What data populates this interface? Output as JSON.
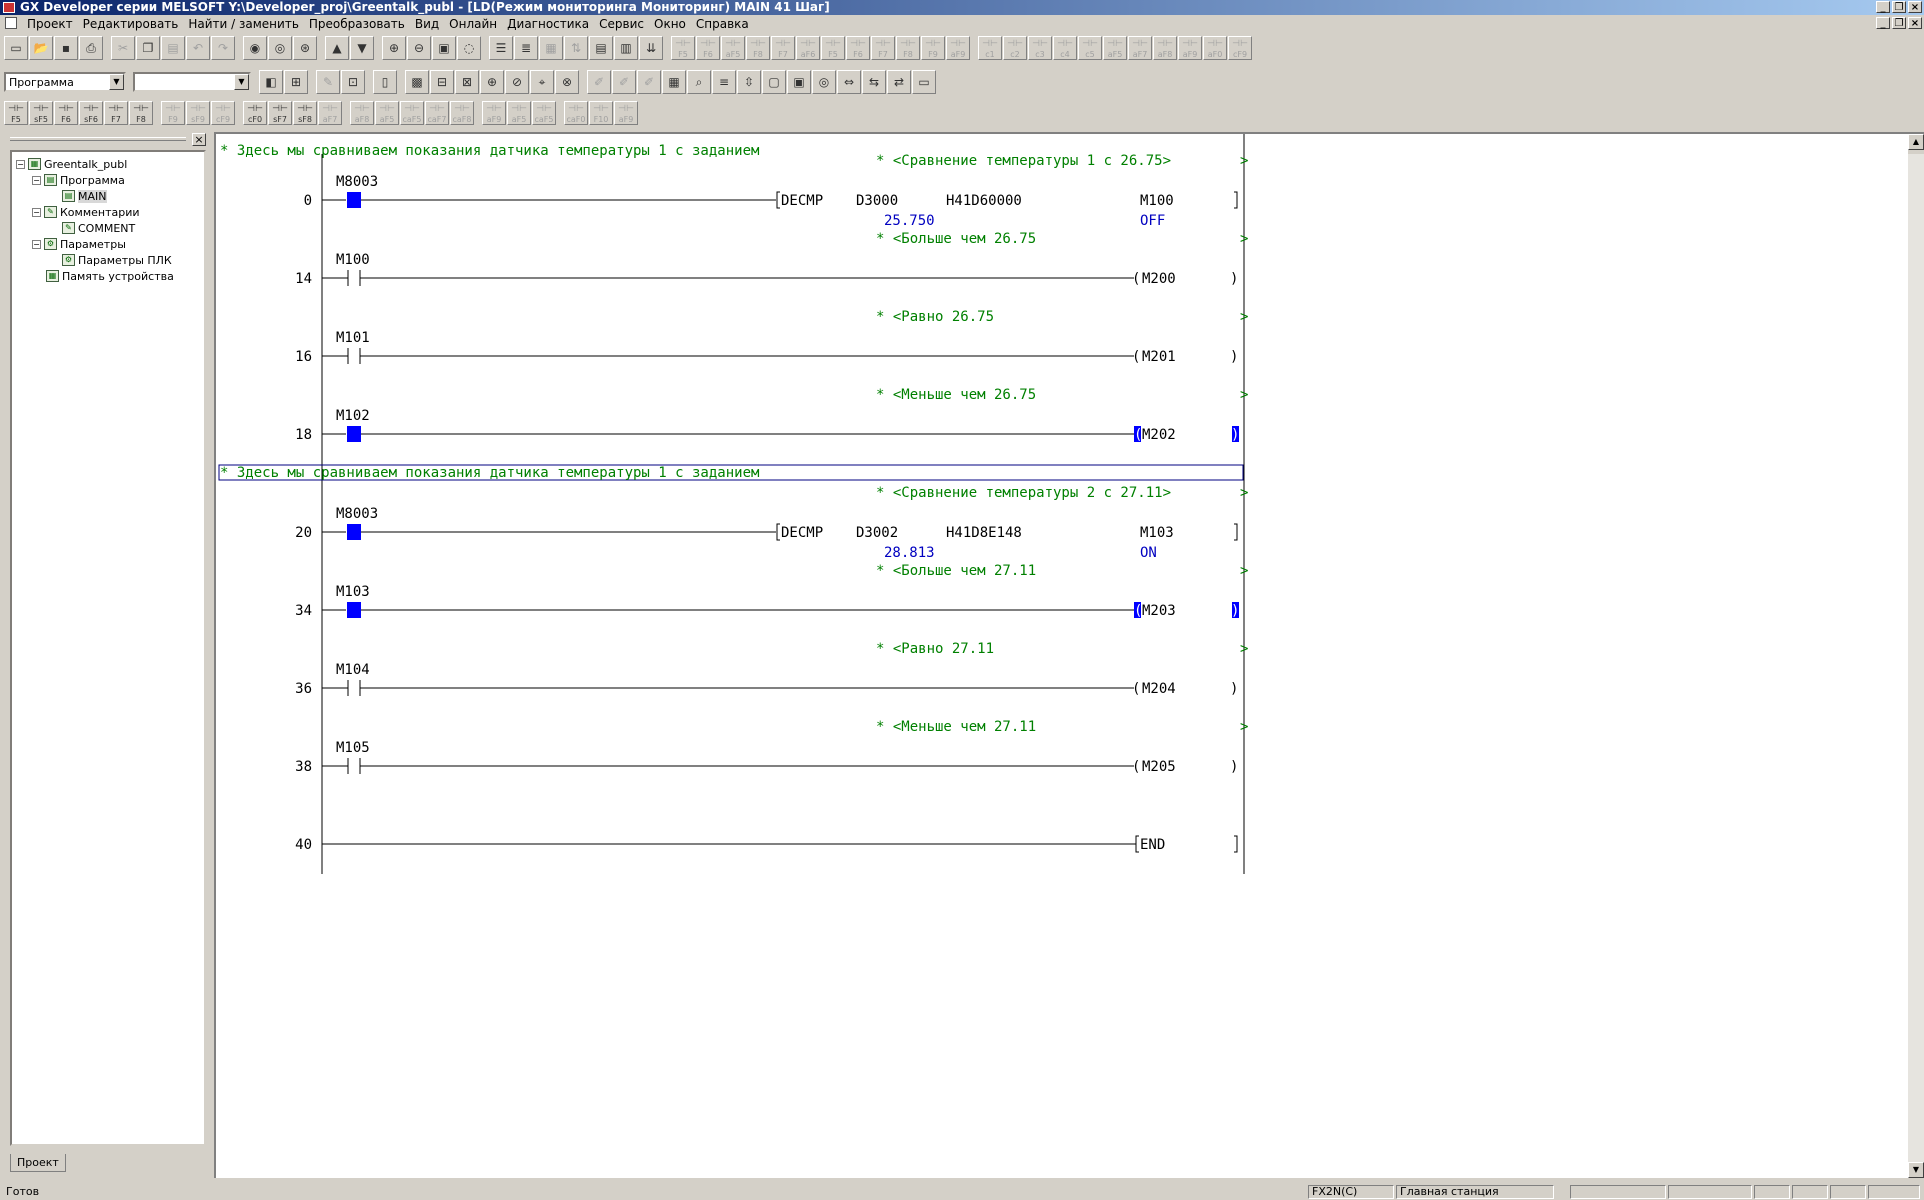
{
  "window": {
    "title": "GX Developer серии MELSOFT Y:\\Developer_proj\\Greentalk_publ - [LD(Режим мониторинга Мониторинг)    MAIN    41 Шаг]"
  },
  "menu": [
    "Проект",
    "Редактировать",
    "Найти / заменить",
    "Преобразовать",
    "Вид",
    "Онлайн",
    "Диагностика",
    "Сервис",
    "Окно",
    "Справка"
  ],
  "toolbar": {
    "data_type_combo": "Программа",
    "second_combo": "",
    "row1_keys": [
      "F5",
      "F6",
      "aF5",
      "F8",
      "F7",
      "aF6",
      "F5",
      "F6",
      "F7",
      "F8",
      "F9",
      "aF9",
      "c1",
      "c2",
      "c3",
      "c4",
      "c5",
      "aF5",
      "aF7",
      "aF8",
      "aF9",
      "aF0",
      "cF9"
    ],
    "row3_keys": [
      "F5",
      "sF5",
      "F6",
      "sF6",
      "F7",
      "F8",
      "F9",
      "sF9",
      "cF9",
      "cF0",
      "sF7",
      "sF8",
      "aF7",
      "aF8",
      "aF5",
      "caF5",
      "caF7",
      "caF8",
      "aF9",
      "aF5",
      "caF5",
      "caF0",
      "F10",
      "aF9"
    ]
  },
  "tree": {
    "root": "Greentalk_publ",
    "program": "Программа",
    "main": "MAIN",
    "comments": "Комментарии",
    "comment": "COMMENT",
    "params": "Параметры",
    "plc_params": "Параметры ПЛК",
    "device_mem": "Память устройства",
    "tab": "Проект"
  },
  "ladder": {
    "comment_block": "* Здесь мы сравниваем показания датчика температуры 1 с  заданием",
    "rungs": [
      {
        "step": "0",
        "note": "* <Сравнение температуры  1 с 26.75>",
        "contact": "M8003",
        "contact_state": "on",
        "instr": "DECMP",
        "src": "D3000",
        "val": "H41D60000",
        "dst": "M100",
        "src_mon": "25.750",
        "dst_mon": "OFF"
      },
      {
        "step": "14",
        "note": "* <Больше чем 26.75",
        "contact": "M100",
        "contact_state": "off",
        "coil": "M200",
        "coil_state": "off"
      },
      {
        "step": "16",
        "note": "* <Равно 26.75",
        "contact": "M101",
        "contact_state": "off",
        "coil": "M201",
        "coil_state": "off"
      },
      {
        "step": "18",
        "note": "* <Меньше чем 26.75",
        "contact": "M102",
        "contact_state": "on",
        "coil": "M202",
        "coil_state": "on"
      },
      {
        "step": "20",
        "note": "* <Сравнение температуры  2 с 27.11>",
        "contact": "M8003",
        "contact_state": "on",
        "instr": "DECMP",
        "src": "D3002",
        "val": "H41D8E148",
        "dst": "M103",
        "src_mon": "28.813",
        "dst_mon": "ON"
      },
      {
        "step": "34",
        "note": "* <Больше чем 27.11",
        "contact": "M103",
        "contact_state": "on",
        "coil": "M203",
        "coil_state": "on"
      },
      {
        "step": "36",
        "note": "* <Равно 27.11",
        "contact": "M104",
        "contact_state": "off",
        "coil": "M204",
        "coil_state": "off"
      },
      {
        "step": "38",
        "note": "* <Меньше чем 27.11",
        "contact": "M105",
        "contact_state": "off",
        "coil": "M205",
        "coil_state": "off"
      },
      {
        "step": "40",
        "end": "END"
      }
    ],
    "colors": {
      "comment": "#008000",
      "monitor": "#0000c0",
      "active": "#0000ff",
      "line": "#000000"
    }
  },
  "status": {
    "ready": "Готов",
    "plc": "FX2N(C)",
    "station": "Главная станция"
  }
}
